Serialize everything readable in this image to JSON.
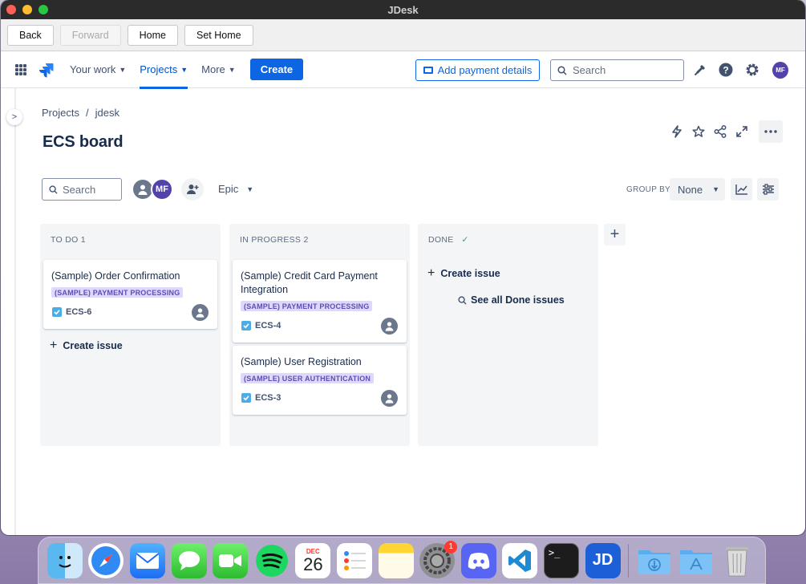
{
  "window": {
    "title": "JDesk"
  },
  "nav": {
    "back": "Back",
    "forward": "Forward",
    "home": "Home",
    "set_home": "Set Home"
  },
  "topbar": {
    "your_work": "Your work",
    "projects": "Projects",
    "more": "More",
    "create": "Create",
    "add_payment": "Add payment details",
    "search_placeholder": "Search",
    "user_initials": "MF"
  },
  "breadcrumb": {
    "projects": "Projects",
    "separator": "/",
    "project": "jdesk"
  },
  "page": {
    "title": "ECS board"
  },
  "toolbar": {
    "search_placeholder": "Search",
    "avatar_initials": "MF",
    "epic": "Epic",
    "group_by_label": "GROUP BY",
    "group_by_value": "None"
  },
  "columns": [
    {
      "title": "TO DO 1",
      "create_issue": "Create issue",
      "issues": [
        {
          "title": "(Sample) Order Confirmation",
          "epic": "(SAMPLE) PAYMENT PROCESSING",
          "key": "ECS-6"
        }
      ]
    },
    {
      "title": "IN PROGRESS 2",
      "issues": [
        {
          "title": "(Sample) Credit Card Payment Integration",
          "epic": "(SAMPLE) PAYMENT PROCESSING",
          "key": "ECS-4"
        },
        {
          "title": "(Sample) User Registration",
          "epic": "(SAMPLE) USER AUTHENTICATION",
          "key": "ECS-3"
        }
      ]
    },
    {
      "title": "DONE",
      "done_check": "✓",
      "create_issue": "Create issue",
      "see_all": "See all Done issues"
    }
  ],
  "dock": {
    "calendar_month": "DEC",
    "calendar_day": "26",
    "settings_badge": "1",
    "terminal_prompt": ">_",
    "jdesk_label": "JD"
  },
  "colors": {
    "primary": "#0c66e4",
    "epic_bg": "#dfd8fd",
    "epic_text": "#5e4db2",
    "avatar": "#5243aa"
  }
}
